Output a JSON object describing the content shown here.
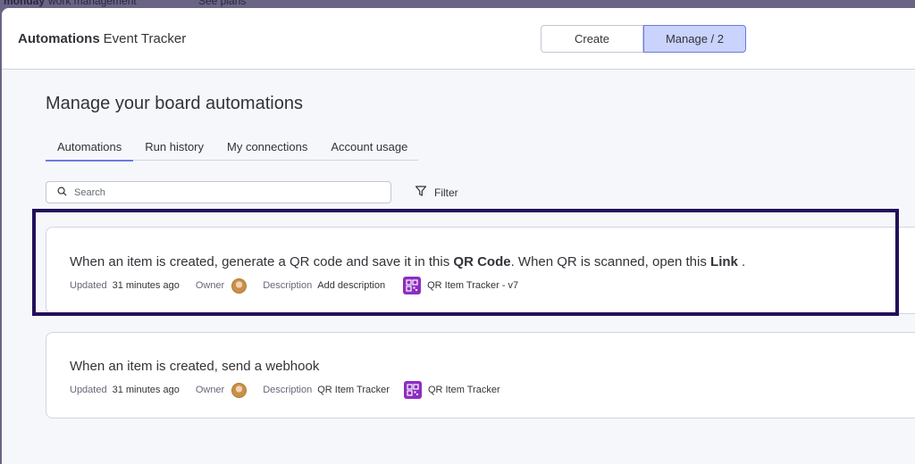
{
  "background": {
    "brand": "monday",
    "brand_sub": "work management",
    "link": "See plans"
  },
  "header": {
    "app_name": "Automations",
    "app_sub": "Event Tracker",
    "create_label": "Create",
    "manage_label": "Manage / 2"
  },
  "page": {
    "title": "Manage your board automations"
  },
  "tabs": [
    {
      "label": "Automations",
      "active": true
    },
    {
      "label": "Run history"
    },
    {
      "label": "My connections"
    },
    {
      "label": "Account usage"
    }
  ],
  "search": {
    "placeholder": "Search"
  },
  "filter": {
    "label": "Filter"
  },
  "cards": [
    {
      "title_parts": [
        "When an item is created, generate a QR code and save it in this ",
        "QR Code",
        ". When QR is scanned, open this ",
        "Link",
        " ."
      ],
      "updated_label": "Updated",
      "updated_value": "31 minutes ago",
      "owner_label": "Owner",
      "description_label": "Description",
      "description_value": "Add description",
      "app_name": "QR Item Tracker - v7"
    },
    {
      "title": "When an item is created, send a webhook",
      "updated_label": "Updated",
      "updated_value": "31 minutes ago",
      "owner_label": "Owner",
      "description_label": "Description",
      "description_value": "QR Item Tracker",
      "app_name": "QR Item Tracker"
    }
  ],
  "colors": {
    "accent": "#6b7be0",
    "selected_bg": "#c9d3fb",
    "highlight": "#220f5a",
    "app_icon": "#8e2dc2"
  }
}
